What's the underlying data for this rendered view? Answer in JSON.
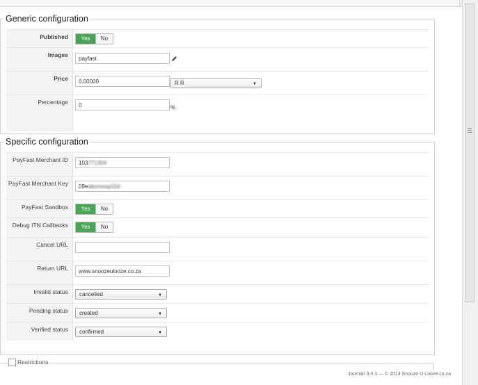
{
  "generic": {
    "legend": "Generic configuration",
    "published": {
      "label": "Published",
      "yes": "Yes",
      "no": "No",
      "value": "Yes"
    },
    "images": {
      "label": "Images",
      "value": "payfast"
    },
    "price": {
      "label": "Price",
      "value": "0.00000",
      "currency": "R R"
    },
    "percentage": {
      "label": "Percentage",
      "value": "0",
      "unit": "%"
    }
  },
  "specific": {
    "legend": "Specific configuration",
    "merchant_id": {
      "label": "PayFast Merchant ID",
      "value_visible": "103",
      "value_obscured": "771304"
    },
    "merchant_key": {
      "label": "PayFast Merchant Key",
      "value_visible": "09e",
      "value_obscured": "abcmnop32d"
    },
    "sandbox": {
      "label": "PayFast Sandbox",
      "yes": "Yes",
      "no": "No",
      "value": "Yes"
    },
    "debug": {
      "label": "Debug ITN Callbacks",
      "yes": "Yes",
      "no": "No",
      "value": "Yes"
    },
    "cancel_url": {
      "label": "Cancel URL",
      "value": ""
    },
    "return_url": {
      "label": "Return URL",
      "value": "www.snoozeulooze.co.za"
    },
    "invalid_status": {
      "label": "Invalid status",
      "value": "cancelled"
    },
    "pending_status": {
      "label": "Pending status",
      "value": "created"
    },
    "verified_status": {
      "label": "Verified status",
      "value": "confirmed"
    }
  },
  "restrictions": {
    "label": "Restrictions"
  },
  "footer": {
    "text": "Joomla! 3.3.3 — © 2014 Snooze U Looze.co.za"
  },
  "icons": {
    "pencil": "pencil-icon",
    "caret": "caret-down-icon",
    "checkbox": "checkbox-icon",
    "grip": "scroll-grip-icon"
  },
  "colors": {
    "toggle_yes": "#49a556",
    "label_bg": "#f3f3f3"
  }
}
